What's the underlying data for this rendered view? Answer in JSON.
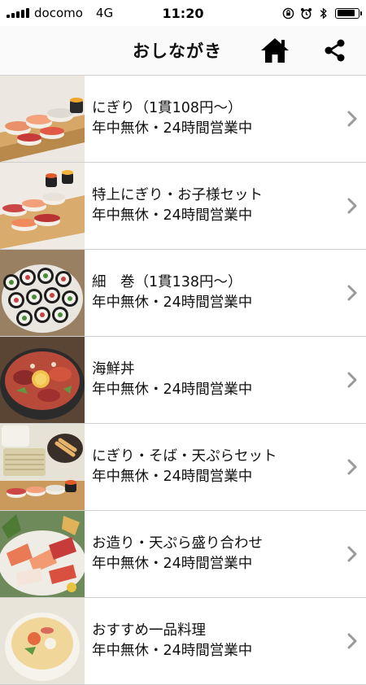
{
  "status_bar": {
    "carrier": "docomo",
    "network": "4G",
    "time": "11:20",
    "battery_level": 0.9
  },
  "header": {
    "title": "おしながき",
    "home_icon": "home-icon",
    "share_icon": "share-icon"
  },
  "menu": {
    "items": [
      {
        "title": "にぎり（1貫108円〜）",
        "subtitle": "年中無休・24時間営業中",
        "thumb": "nigiri-plate"
      },
      {
        "title": "特上にぎり・お子様セット",
        "subtitle": "年中無休・24時間営業中",
        "thumb": "premium-nigiri-set"
      },
      {
        "title": "細　巻（1貫138円〜）",
        "subtitle": "年中無休・24時間営業中",
        "thumb": "hosomaki-rolls"
      },
      {
        "title": "海鮮丼",
        "subtitle": "年中無休・24時間営業中",
        "thumb": "kaisendon-bowl"
      },
      {
        "title": "にぎり・そば・天ぷらセット",
        "subtitle": "年中無休・24時間営業中",
        "thumb": "nigiri-soba-tempura-set"
      },
      {
        "title": "お造り・天ぷら盛り合わせ",
        "subtitle": "年中無休・24時間営業中",
        "thumb": "sashimi-tempura-platter"
      },
      {
        "title": "おすすめ一品料理",
        "subtitle": "年中無休・24時間営業中",
        "thumb": "chawanmushi-dish"
      }
    ]
  },
  "colors": {
    "chevron": "#9a9a9a",
    "divider": "#cfcfcf",
    "header_bg": "#fafafa"
  }
}
